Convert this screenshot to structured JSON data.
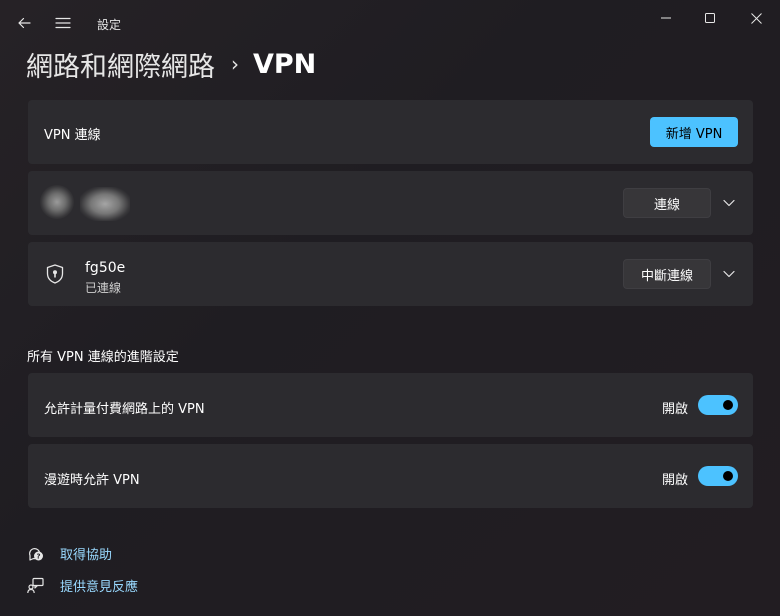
{
  "window": {
    "title": "設定",
    "back_icon": "back-arrow-icon",
    "menu_icon": "hamburger-menu-icon",
    "controls": [
      "minimize-icon",
      "maximize-icon",
      "close-icon"
    ]
  },
  "breadcrumb": {
    "parent": "網路和網際網路",
    "separator": "›",
    "current": "VPN"
  },
  "vpn_header": {
    "label": "VPN 連線",
    "add_button": "新增 VPN"
  },
  "vpn_connections": [
    {
      "name": "",
      "status": "",
      "button": "連線",
      "icon": "blurred-redacted"
    },
    {
      "name": "fg50e",
      "status": "已連線",
      "button": "中斷連線",
      "icon": "vpn-shield-icon"
    }
  ],
  "advanced": {
    "title": "所有 VPN 連線的進階設定",
    "settings": [
      {
        "label": "允許計量付費網路上的 VPN",
        "state_text": "開啟",
        "on": true
      },
      {
        "label": "漫遊時允許 VPN",
        "state_text": "開啟",
        "on": true
      }
    ]
  },
  "links": [
    {
      "label": "取得協助",
      "icon": "help-chat-icon"
    },
    {
      "label": "提供意見反應",
      "icon": "feedback-icon"
    }
  ],
  "colors": {
    "accent": "#4cc2ff",
    "link": "#99d9ff",
    "card": "#2c2b2f"
  }
}
